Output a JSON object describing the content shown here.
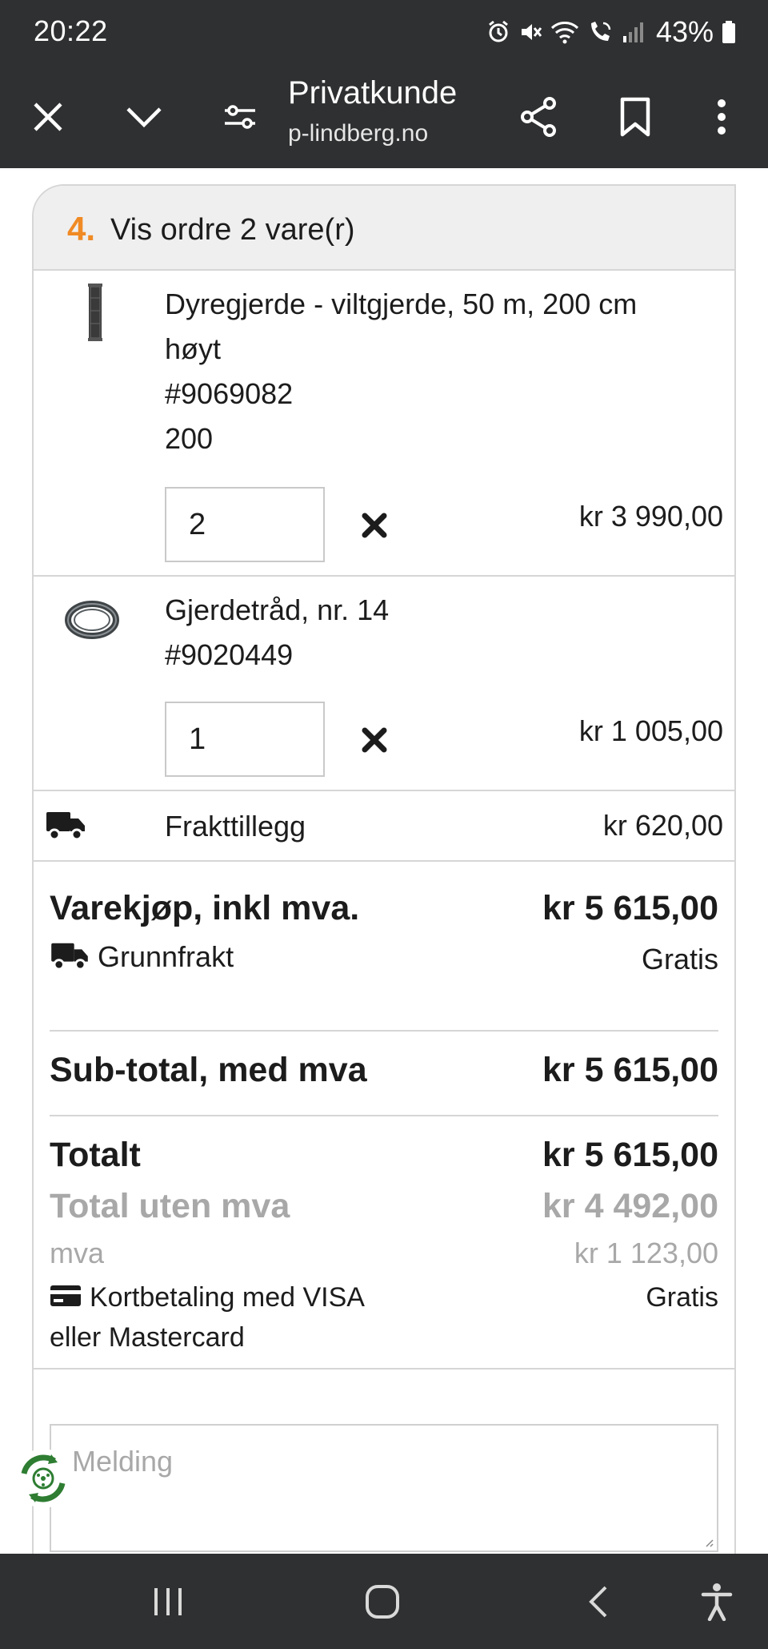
{
  "status_bar": {
    "time": "20:22",
    "battery": "43%",
    "icons": [
      "alarm-icon",
      "mute-icon",
      "wifi-icon",
      "wifi-calling-icon",
      "signal-icon",
      "battery-icon"
    ]
  },
  "browser": {
    "title": "Privatkunde",
    "url": "p-lindberg.no",
    "buttons": [
      "close-icon",
      "chevron-down-icon",
      "tune-icon",
      "share-icon",
      "bookmark-icon",
      "more-vertical-icon"
    ]
  },
  "order": {
    "step_number": "4.",
    "title": "Vis ordre 2 vare(r)",
    "items": [
      {
        "name_line1": "Dyregjerde - viltgjerde, 50 m, 200 cm",
        "name_line2": "høyt",
        "sku": "#9069082",
        "variant": "200",
        "quantity": "2",
        "price": "kr 3 990,00"
      },
      {
        "name_line1": "Gjerdetråd, nr. 14",
        "sku": "#9020449",
        "quantity": "1",
        "price": "kr 1 005,00"
      }
    ],
    "freight": {
      "label": "Frakttillegg",
      "price": "kr 620,00"
    }
  },
  "summary": {
    "purchase_label": "Varekjøp, inkl mva.",
    "purchase_value": "kr 5 615,00",
    "base_freight_label": "Grunnfrakt",
    "base_freight_value": "Gratis",
    "subtotal_label": "Sub-total, med mva",
    "subtotal_value": "kr 5 615,00",
    "total_label": "Totalt",
    "total_value": "kr 5 615,00",
    "total_ex_vat_label": "Total uten mva",
    "total_ex_vat_value": "kr 4 492,00",
    "vat_label": "mva",
    "vat_value": "kr 1 123,00",
    "payment_label_line1": "Kortbetaling med VISA",
    "payment_label_line2": "eller Mastercard",
    "payment_value": "Gratis"
  },
  "message": {
    "placeholder": "Melding"
  },
  "colors": {
    "accent": "#f08a24",
    "bar": "#2f3031",
    "border": "#d6d6d6",
    "muted": "#a8a8a8"
  }
}
